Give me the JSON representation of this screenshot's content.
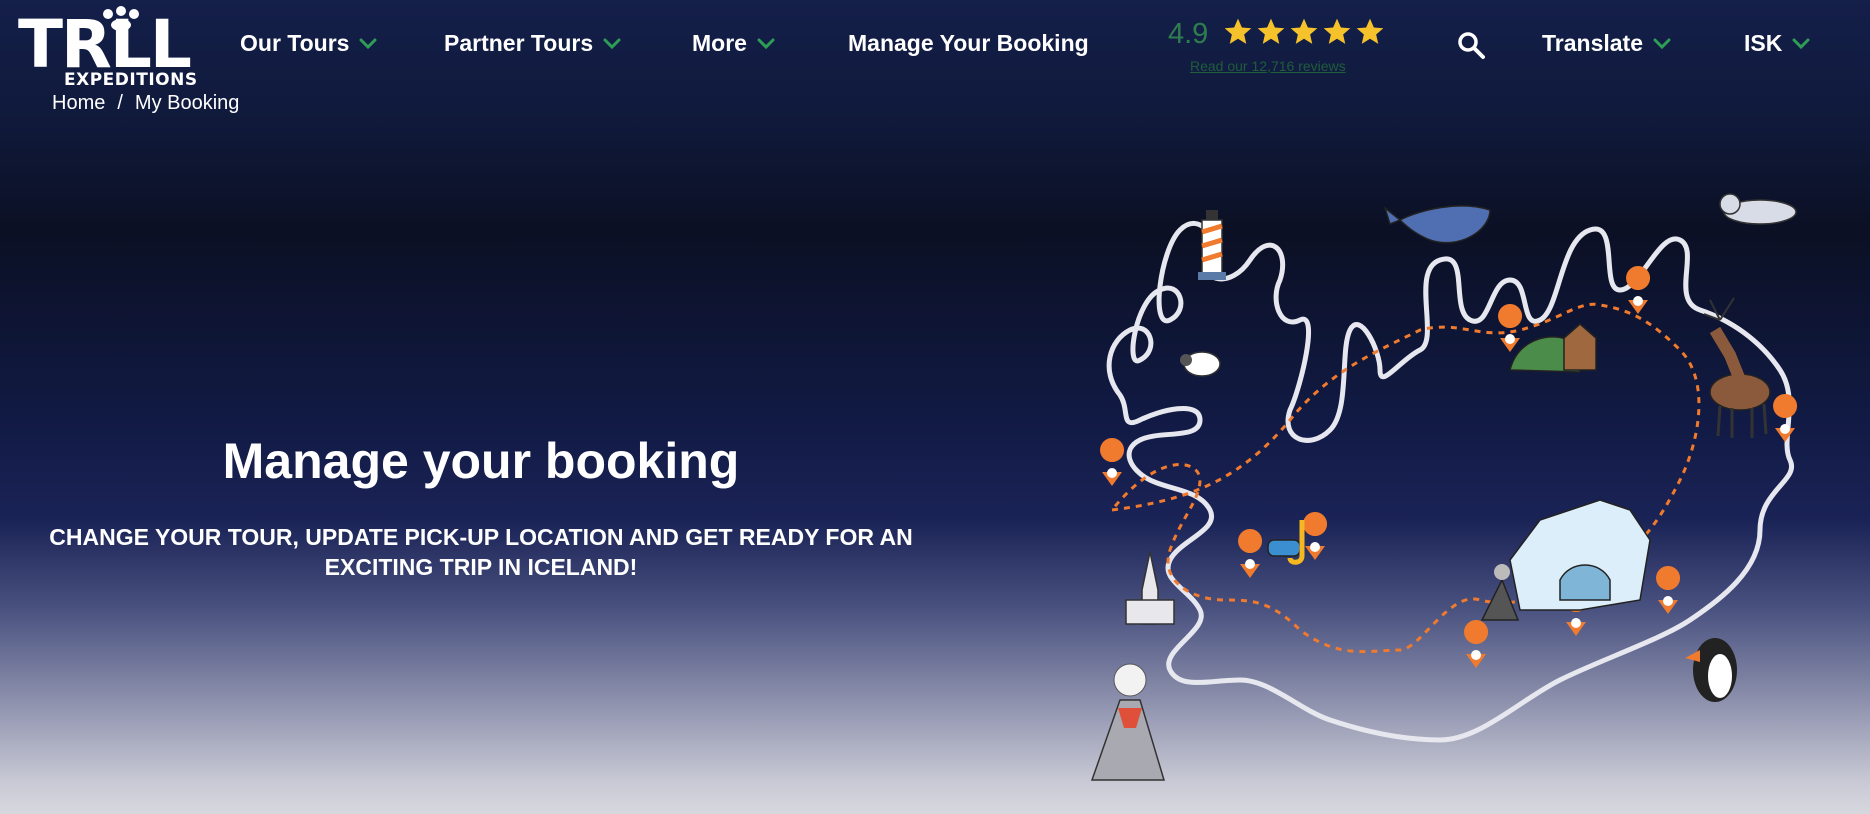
{
  "header": {
    "logo": {
      "main": "TRLL",
      "sub": "EXPEDITIONS"
    },
    "nav": [
      {
        "label": "Our Tours",
        "has_dropdown": true
      },
      {
        "label": "Partner Tours",
        "has_dropdown": true
      },
      {
        "label": "More",
        "has_dropdown": true
      },
      {
        "label": "Manage Your Booking",
        "has_dropdown": false
      }
    ],
    "rating": {
      "score": "4.9",
      "stars": 5,
      "reviews_link": "Read our 12,716 reviews"
    },
    "search_icon": "search-icon",
    "translate": {
      "label": "Translate"
    },
    "currency": {
      "label": "ISK"
    }
  },
  "breadcrumb": {
    "home": "Home",
    "separator": "/",
    "current": "My Booking"
  },
  "hero": {
    "title": "Manage your booking",
    "subtitle_line1": "CHANGE YOUR TOUR, UPDATE PICK-UP LOCATION AND GET READY FOR AN",
    "subtitle_line2": "EXCITING TRIP IN ICELAND!"
  },
  "colors": {
    "accent_green": "#2e7d4f",
    "star_yellow": "#f6c22b",
    "route_orange": "#f07a2e",
    "map_outline": "#e6e7ef"
  }
}
